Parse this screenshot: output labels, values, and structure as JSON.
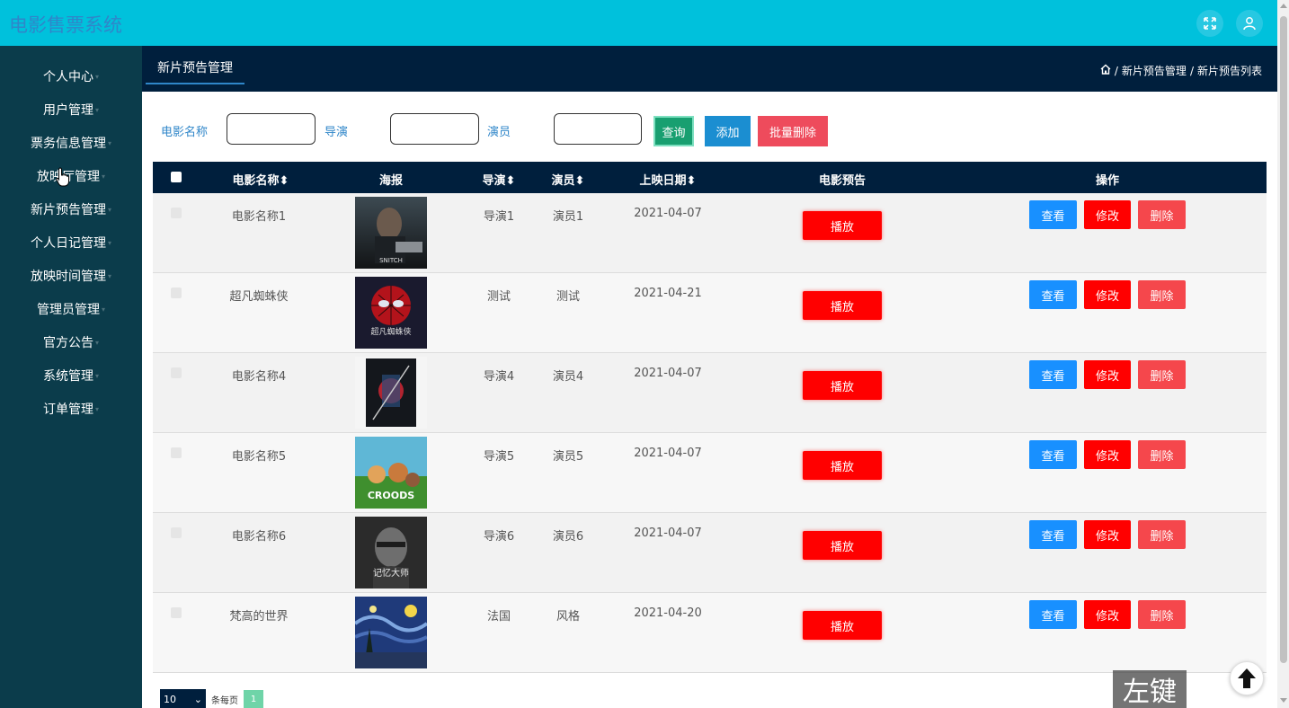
{
  "app": {
    "title": "电影售票系统"
  },
  "colors": {
    "topbar": "#00c1dc",
    "sidebar": "#0b3c4b",
    "header": "#001f3d",
    "play": "#ff0000",
    "view": "#1890ff",
    "edit": "#ff0000",
    "delete": "#f5474c"
  },
  "topbar": {
    "fullscreen_icon": "fullscreen-icon",
    "user_icon": "user-icon"
  },
  "sidebar": {
    "items": [
      {
        "label": "个人中心"
      },
      {
        "label": "用户管理"
      },
      {
        "label": "票务信息管理"
      },
      {
        "label": "放映厅管理"
      },
      {
        "label": "新片预告管理"
      },
      {
        "label": "个人日记管理"
      },
      {
        "label": "放映时间管理"
      },
      {
        "label": "管理员管理"
      },
      {
        "label": "官方公告"
      },
      {
        "label": "系统管理"
      },
      {
        "label": "订单管理"
      }
    ]
  },
  "header": {
    "tab": "新片预告管理",
    "breadcrumb": {
      "sep1": "/",
      "item1": "新片预告管理",
      "sep2": "/",
      "item2": "新片预告列表"
    }
  },
  "search": {
    "name_label": "电影名称",
    "director_label": "导演",
    "actor_label": "演员",
    "name_value": "",
    "director_value": "",
    "actor_value": "",
    "query_btn": "查询",
    "add_btn": "添加",
    "batch_delete_btn": "批量删除"
  },
  "table": {
    "headers": {
      "name": "电影名称",
      "poster": "海报",
      "director": "导演",
      "actor": "演员",
      "date": "上映日期",
      "trailer": "电影预告",
      "ops": "操作"
    },
    "rows": [
      {
        "name": "电影名称1",
        "director": "导演1",
        "actor": "演员1",
        "date": "2021-04-07",
        "play": "播放",
        "view": "查看",
        "edit": "修改",
        "del": "删除"
      },
      {
        "name": "超凡蜘蛛侠",
        "director": "测试",
        "actor": "测试",
        "date": "2021-04-21",
        "play": "播放",
        "view": "查看",
        "edit": "修改",
        "del": "删除"
      },
      {
        "name": "电影名称4",
        "director": "导演4",
        "actor": "演员4",
        "date": "2021-04-07",
        "play": "播放",
        "view": "查看",
        "edit": "修改",
        "del": "删除"
      },
      {
        "name": "电影名称5",
        "director": "导演5",
        "actor": "演员5",
        "date": "2021-04-07",
        "play": "播放",
        "view": "查看",
        "edit": "修改",
        "del": "删除"
      },
      {
        "name": "电影名称6",
        "director": "导演6",
        "actor": "演员6",
        "date": "2021-04-07",
        "play": "播放",
        "view": "查看",
        "edit": "修改",
        "del": "删除"
      },
      {
        "name": "梵高的世界",
        "director": "法国",
        "actor": "风格",
        "date": "2021-04-20",
        "play": "播放",
        "view": "查看",
        "edit": "修改",
        "del": "删除"
      }
    ]
  },
  "pager": {
    "page_size": "10",
    "per_page_label": "条每页",
    "current_page": "1"
  },
  "overlay": {
    "left_key_label": "左键"
  }
}
